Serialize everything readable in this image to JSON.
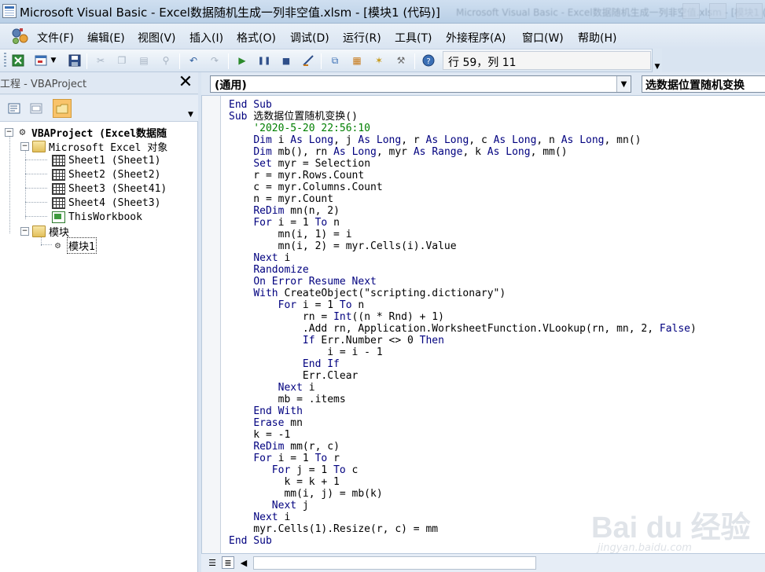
{
  "window": {
    "title": "Microsoft Visual Basic - Excel数据随机生成一列非空值.xlsm - [模块1 (代码)]"
  },
  "menu": {
    "items": [
      "文件(F)",
      "编辑(E)",
      "视图(V)",
      "插入(I)",
      "格式(O)",
      "调试(D)",
      "运行(R)",
      "工具(T)",
      "外接程序(A)",
      "窗口(W)",
      "帮助(H)"
    ]
  },
  "toolbar": {
    "position_text": "行 59，列 11"
  },
  "project": {
    "title": "工程 - VBAProject",
    "tree": {
      "root": "VBAProject (Excel数据随",
      "excel_objects": "Microsoft Excel 对象",
      "sheets": [
        "Sheet1 (Sheet1)",
        "Sheet2 (Sheet2)",
        "Sheet3 (Sheet41)",
        "Sheet4 (Sheet3)"
      ],
      "workbook": "ThisWorkbook",
      "modules_folder": "模块",
      "module": "模块1"
    }
  },
  "code": {
    "object_dropdown": "(通用)",
    "procedure_dropdown": "选数据位置随机变换",
    "lines": [
      "End Sub",
      "Sub 选数据位置随机变换()",
      "    '2020-5-20 22:56:10",
      "    Dim i As Long, j As Long, r As Long, c As Long, n As Long, mn()",
      "    Dim mb(), rn As Long, myr As Range, k As Long, mm()",
      "    Set myr = Selection",
      "    r = myr.Rows.Count",
      "    c = myr.Columns.Count",
      "    n = myr.Count",
      "    ReDim mn(n, 2)",
      "    For i = 1 To n",
      "        mn(i, 1) = i",
      "        mn(i, 2) = myr.Cells(i).Value",
      "    Next i",
      "    Randomize",
      "    On Error Resume Next",
      "    With CreateObject(\"scripting.dictionary\")",
      "        For i = 1 To n",
      "            rn = Int((n * Rnd) + 1)",
      "            .Add rn, Application.WorksheetFunction.VLookup(rn, mn, 2, False)",
      "            If Err.Number <> 0 Then",
      "                i = i - 1",
      "            End If",
      "            Err.Clear",
      "        Next i",
      "        mb = .items",
      "    End With",
      "    Erase mn",
      "    k = -1",
      "    ReDim mm(r, c)",
      "    For i = 1 To r",
      "       For j = 1 To c",
      "         k = k + 1",
      "         mm(i, j) = mb(k)",
      "       Next j",
      "    Next i",
      "    myr.Cells(1).Resize(r, c) = mm",
      "End Sub"
    ]
  },
  "watermark": {
    "brand": "Bai du 经验",
    "url": "jingyan.baidu.com"
  }
}
